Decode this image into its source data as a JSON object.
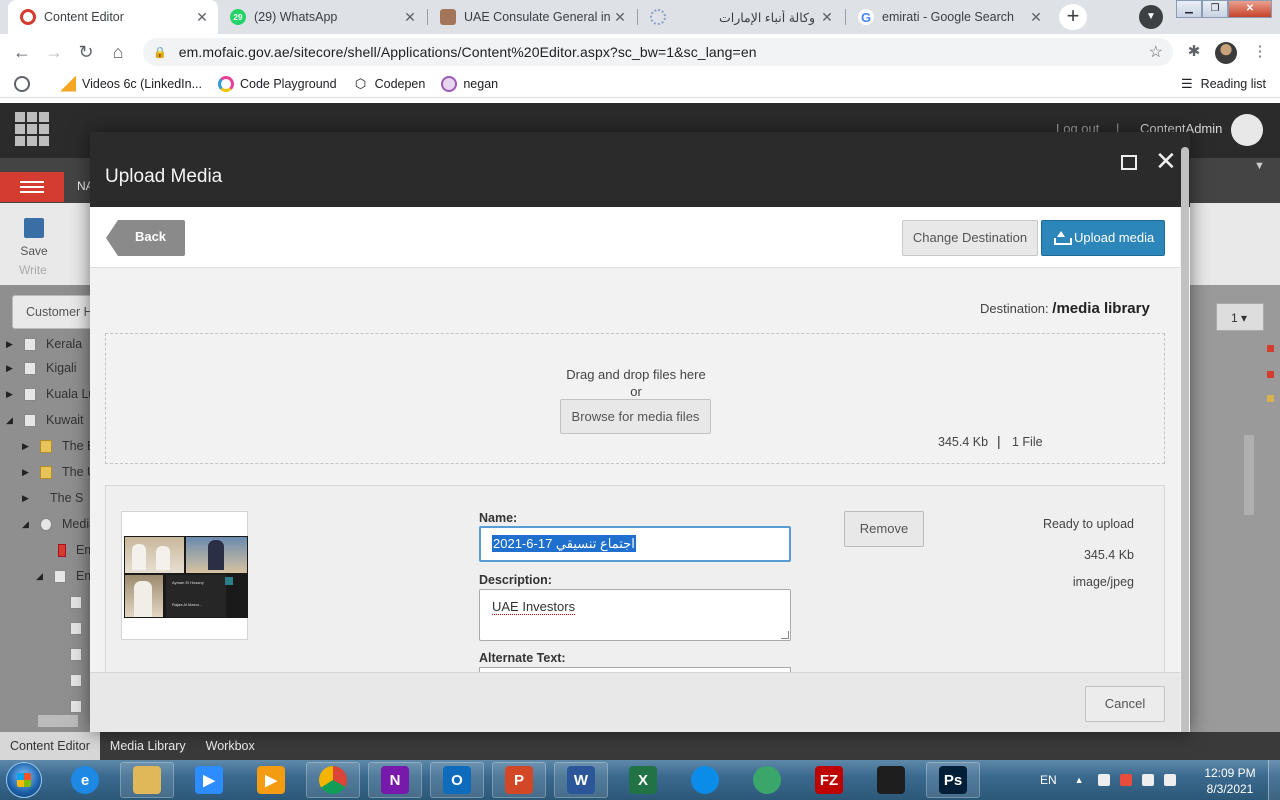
{
  "browser": {
    "tabs": [
      {
        "title": "Content Editor",
        "active": true,
        "icon": "sitecore-icon",
        "color": "#d33c2f"
      },
      {
        "title": "(29) WhatsApp",
        "active": false,
        "icon": "whatsapp-icon",
        "color": "#25d366"
      },
      {
        "title": "UAE Consulate General in N",
        "active": false,
        "icon": "uae-emblem-icon",
        "color": "#a3765a"
      },
      {
        "title": "",
        "active": false,
        "icon": "loading-icon",
        "color": "#8aa0c8"
      },
      {
        "title": "وكالة أنباء الإمارات",
        "active": false,
        "icon": "wam-icon",
        "color": "#c7a24a"
      },
      {
        "title": "emirati - Google Search",
        "active": false,
        "icon": "google-icon",
        "color": "#4285f4"
      }
    ],
    "url": "em.mofaic.gov.ae/sitecore/shell/Applications/Content%20Editor.aspx?sc_bw=1&sc_lang=en",
    "bookmarks": [
      {
        "label": "Videos 6c (LinkedIn...",
        "icon": "linkedin-learning-icon",
        "color": "#f5a623"
      },
      {
        "label": "Code Playground",
        "icon": "code-playground-icon",
        "color": "#e84393"
      },
      {
        "label": "Codepen",
        "icon": "codepen-icon",
        "color": "#111111"
      },
      {
        "label": "negan",
        "icon": "negan-icon",
        "color": "#9b59b6"
      }
    ],
    "reading_list": "Reading list"
  },
  "sitecore": {
    "logout": "Log out",
    "separator": "|",
    "user": "ContentAdmin",
    "nav_label": "NA",
    "save_label": "Save",
    "write_label": "Write",
    "search_placeholder": "Customer H",
    "tree": [
      {
        "label": "Kerala",
        "icon": "page"
      },
      {
        "label": "Kigali",
        "icon": "page"
      },
      {
        "label": "Kuala Lu",
        "icon": "page"
      },
      {
        "label": "Kuwait",
        "icon": "page"
      },
      {
        "label": "The E",
        "icon": "folder"
      },
      {
        "label": "The U",
        "icon": "folder"
      },
      {
        "label": "The S",
        "icon": "none"
      },
      {
        "label": "Media",
        "icon": "media"
      },
      {
        "label": "Em",
        "icon": "megaphone"
      },
      {
        "label": "Em",
        "icon": "media"
      }
    ],
    "bottom_tabs": [
      "Content Editor",
      "Media Library",
      "Workbox"
    ],
    "pager_value": "1"
  },
  "modal": {
    "title": "Upload Media",
    "back_label": "Back",
    "change_destination_label": "Change Destination",
    "upload_media_label": "Upload media",
    "destination_prefix": "Destination:",
    "destination_value": "/media library",
    "dropzone": {
      "line1": "Drag and drop files here",
      "line2": "or",
      "browse_label": "Browse for media files",
      "total_size": "345.4 Kb",
      "separator": "|",
      "file_count": "1  File"
    },
    "file": {
      "name_label": "Name:",
      "name_value": "اجتماع تنسيقي 17-6-2021",
      "description_label": "Description:",
      "description_value": "UAE Investors",
      "alt_label": "Alternate Text:",
      "remove_label": "Remove",
      "status": "Ready to upload",
      "size": "345.4 Kb",
      "mime": "image/jpeg",
      "thumb_names": [
        "Ayman El Hosany",
        "Rajaa Al Mazro..."
      ]
    },
    "cancel_label": "Cancel"
  },
  "taskbar": {
    "apps": [
      {
        "icon": "internet-explorer-icon",
        "color": "#1e88e5",
        "glyph": "e"
      },
      {
        "icon": "file-explorer-icon",
        "color": "#e0b85a",
        "glyph": ""
      },
      {
        "icon": "zoom-icon",
        "color": "#2d8cff",
        "glyph": "▶"
      },
      {
        "icon": "media-player-icon",
        "color": "#f39c12",
        "glyph": "▶"
      },
      {
        "icon": "chrome-icon",
        "color": "#db4437",
        "glyph": ""
      },
      {
        "icon": "onenote-icon",
        "color": "#7719aa",
        "glyph": "N"
      },
      {
        "icon": "outlook-icon",
        "color": "#0f6cbd",
        "glyph": "O"
      },
      {
        "icon": "powerpoint-icon",
        "color": "#d24726",
        "glyph": "P"
      },
      {
        "icon": "word-icon",
        "color": "#2b579a",
        "glyph": "W"
      },
      {
        "icon": "excel-icon",
        "color": "#217346",
        "glyph": "X"
      },
      {
        "icon": "edge-icon",
        "color": "#0c8ce9",
        "glyph": ""
      },
      {
        "icon": "globe-app-icon",
        "color": "#3aa66a",
        "glyph": ""
      },
      {
        "icon": "filezilla-icon",
        "color": "#bf0000",
        "glyph": "FZ"
      },
      {
        "icon": "figma-icon",
        "color": "#1e1e1e",
        "glyph": ""
      },
      {
        "icon": "photoshop-icon",
        "color": "#001e36",
        "glyph": "Ps"
      }
    ],
    "language": "EN",
    "time": "12:09 PM",
    "date": "8/3/2021"
  }
}
